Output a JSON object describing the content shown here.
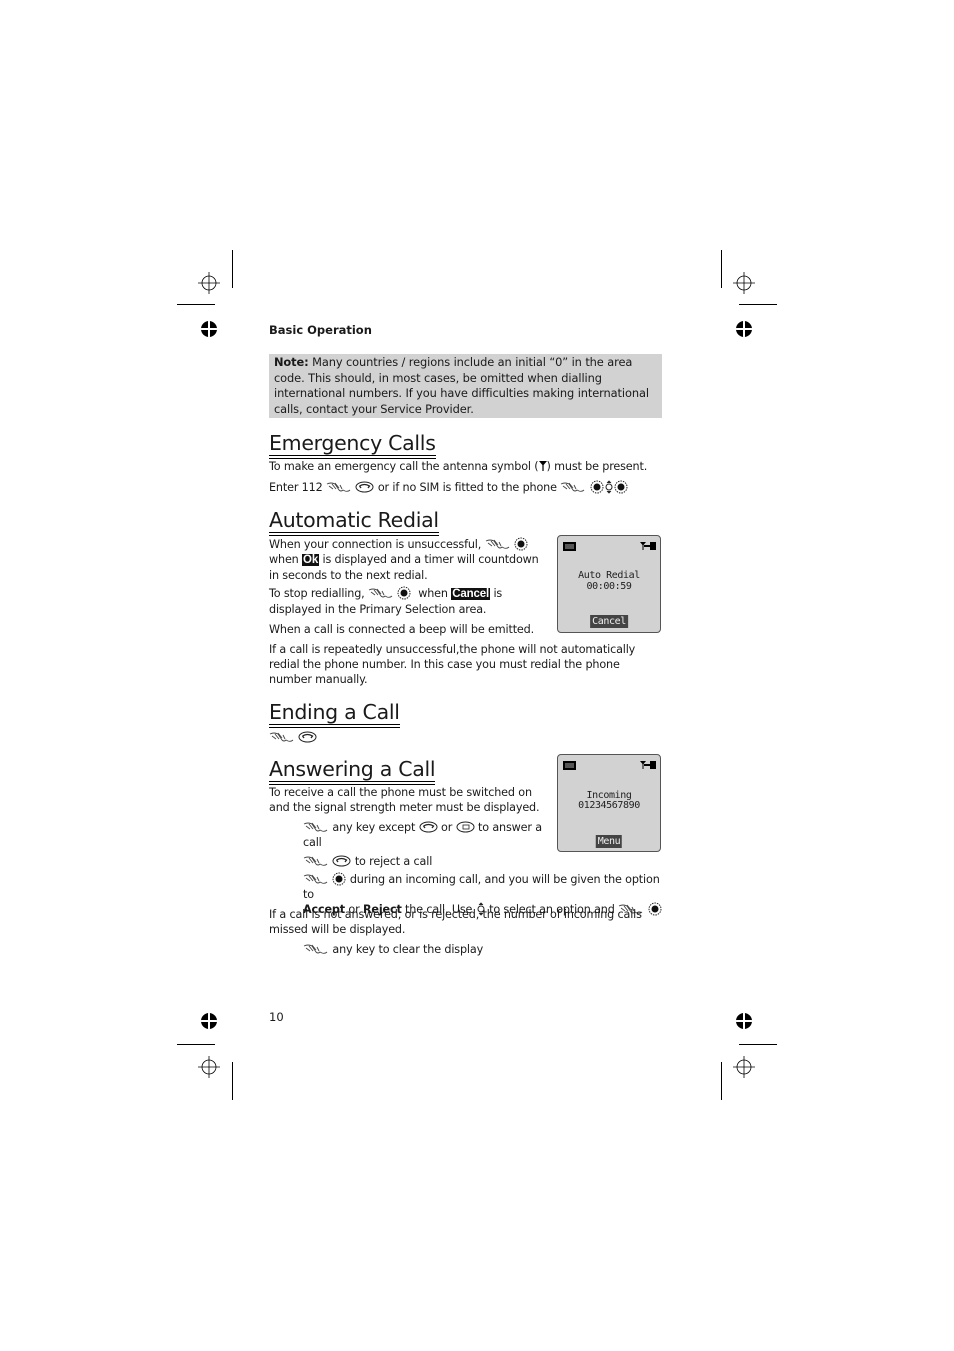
{
  "header": {
    "section": "Basic Operation"
  },
  "note": {
    "label": "Note:",
    "text": " Many countries / regions  include an initial “0” in the area code. This should, in most cases, be omitted when dialling international numbers. If you have difficulties making international calls, contact your Service Provider."
  },
  "emergency": {
    "title": "Emergency Calls",
    "line1": "To make an emergency call the antenna symbol (",
    "line1_end": ") must be present.",
    "line2_a": "Enter 112",
    "line2_b": "or if no SIM is fitted to the phone"
  },
  "redial": {
    "title": "Automatic Redial",
    "p1_a": "When your connection is unsuccessful,",
    "p1_b": "when",
    "p1_ok": "Ok",
    "p1_c": "is displayed and a timer will countdown in seconds to the next redial.",
    "p2_a": "To stop redialling,",
    "p2_b": "when",
    "p2_cancel": "Cancel",
    "p2_c": "is displayed in the Primary Selection area.",
    "p3": "When a call is connected a beep will be emitted.",
    "p4": "If a call is repeatedly unsuccessful,the phone  will not automatically redial the phone number. In this case you must redial the phone number manually.",
    "screen": {
      "line1": "Auto Redial",
      "line2": "00:00:59",
      "softkey": "Cancel"
    }
  },
  "ending": {
    "title": "Ending a Call"
  },
  "answering": {
    "title": "Answering a Call",
    "p1": "To receive a call the phone must be switched on and the signal strength meter must be displayed.",
    "s1_a": "any key except",
    "s1_b": "or",
    "s1_c": "to answer a call",
    "s2": "to reject a call",
    "s3_a": "during an incoming call, and you will be given the option to",
    "s3_accept": "Accept",
    "s3_or": " or ",
    "s3_reject": "Reject",
    "s3_b": " the call. Use",
    "s3_c": "to select an option and",
    "p2": "If a call is not answered, or is rejected, the number of incoming calls missed will be displayed.",
    "s4": "any key to clear the display",
    "screen": {
      "line1": "Incoming",
      "line2": "01234567890",
      "softkey": "Menu"
    }
  },
  "icons": {
    "press": "hand-press-icon",
    "end_key": "end-call-key-icon",
    "select_key": "select-key-icon",
    "menu_key": "menu-key-icon",
    "nav_key": "navigation-key-icon",
    "antenna": "antenna-icon",
    "battery": "battery-icon"
  },
  "footer": {
    "page_number": "10"
  }
}
